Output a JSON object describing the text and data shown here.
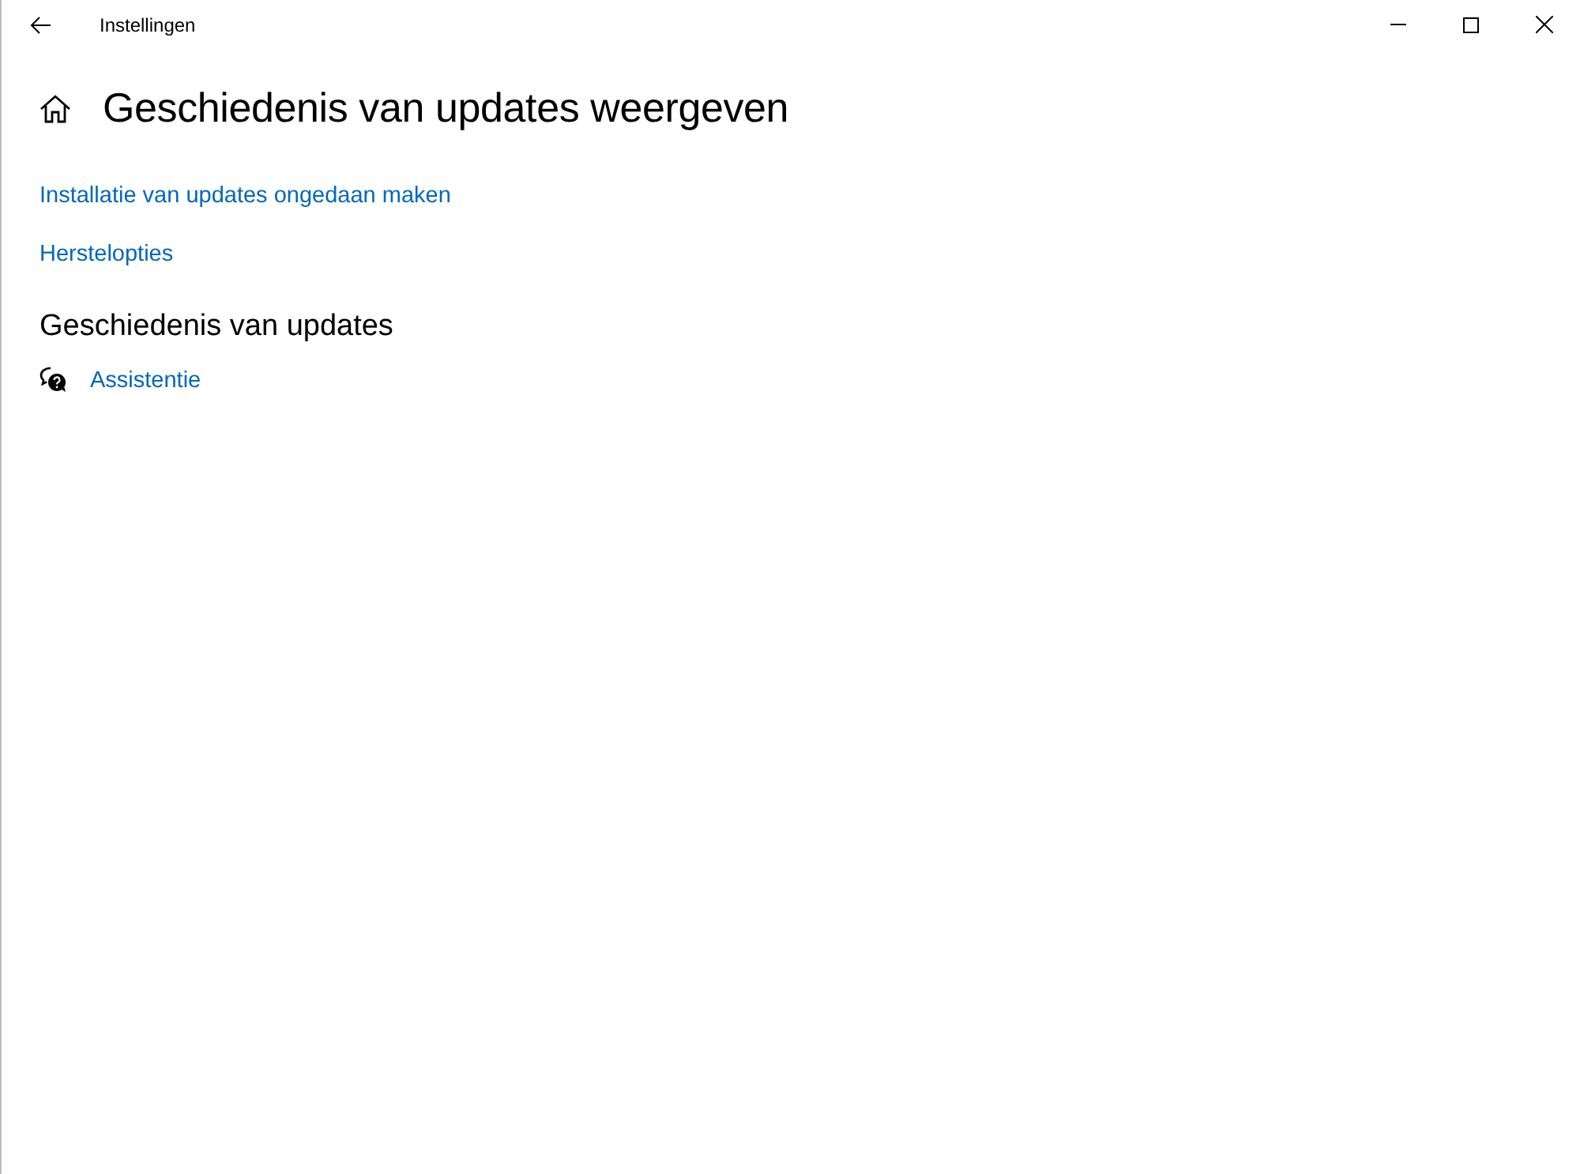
{
  "window": {
    "title": "Instellingen"
  },
  "page": {
    "title": "Geschiedenis van updates weergeven"
  },
  "links": [
    "Installatie van updates ongedaan maken",
    "Herstelopties"
  ],
  "section": {
    "title": "Geschiedenis van updates"
  },
  "help_link": "Assistentie"
}
